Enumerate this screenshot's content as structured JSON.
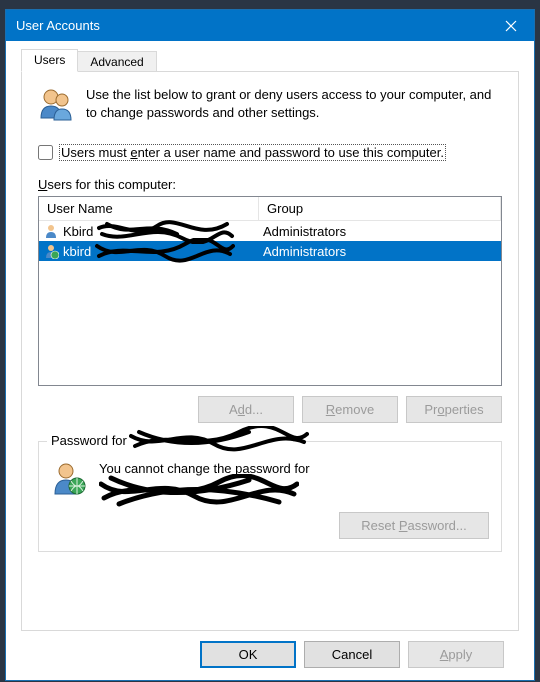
{
  "window": {
    "title": "User Accounts"
  },
  "tabs": {
    "users": "Users",
    "advanced": "Advanced"
  },
  "intro_text": "Use the list below to grant or deny users access to your computer, and to change passwords and other settings.",
  "checkbox_label_pre": "Users must ",
  "checkbox_label_u": "e",
  "checkbox_label_post": "nter a user name and password to use this computer.",
  "list_label_pre": "",
  "list_label_u": "U",
  "list_label_post": "sers for this computer:",
  "columns": {
    "name": "User Name",
    "group": "Group"
  },
  "rows": [
    {
      "name_visible": "Kbird",
      "group": "Administrators",
      "selected": false
    },
    {
      "name_visible": "kbird",
      "group": "Administrators",
      "selected": true
    }
  ],
  "buttons": {
    "add_pre": "A",
    "add_u": "d",
    "add_post": "d...",
    "remove_u": "R",
    "remove_post": "emove",
    "properties_pre": "Pr",
    "properties_u": "o",
    "properties_post": "perties",
    "reset_pre": "Reset ",
    "reset_u": "P",
    "reset_post": "assword...",
    "ok": "OK",
    "cancel": "Cancel",
    "apply_u": "A",
    "apply_post": "pply"
  },
  "password_group": {
    "legend_prefix": "Password for",
    "body_text": "You cannot change the password for"
  }
}
